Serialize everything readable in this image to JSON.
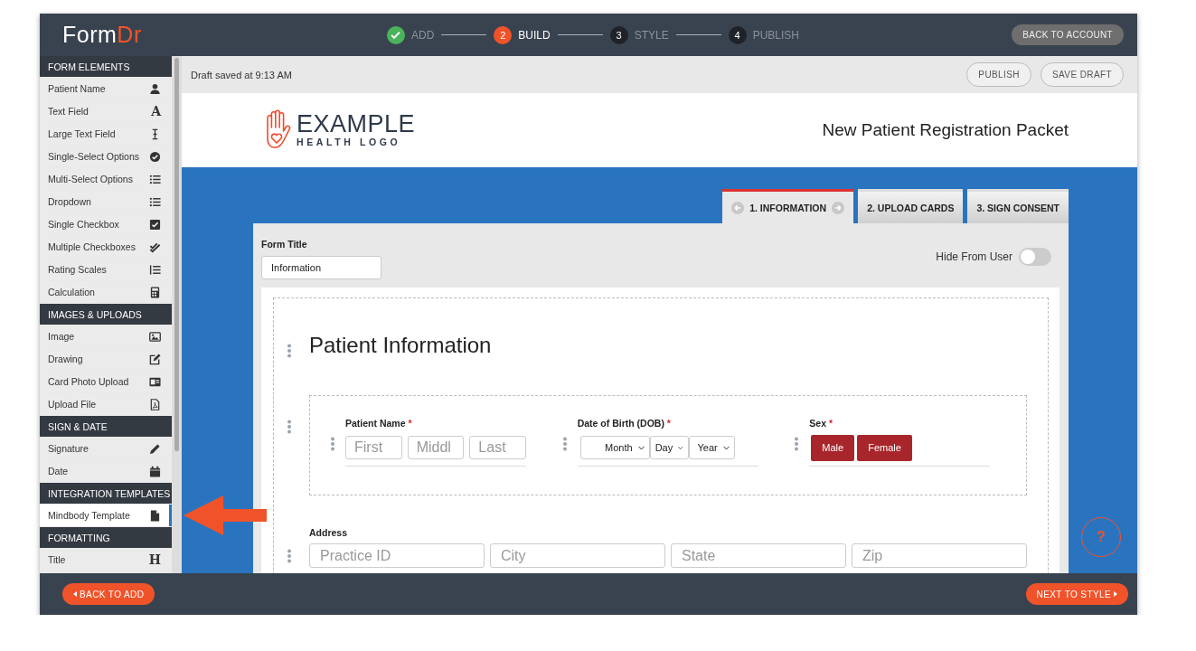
{
  "logo": [
    "Form",
    "Dr"
  ],
  "steps": [
    {
      "label": "ADD",
      "completed": true,
      "selected": false
    },
    {
      "number": "2",
      "label": "BUILD",
      "completed": false,
      "selected": true
    },
    {
      "number": "3",
      "label": "STYLE",
      "completed": false,
      "selected": false
    },
    {
      "number": "4",
      "label": "PUBLISH",
      "completed": false,
      "selected": false
    }
  ],
  "account_button": "BACK TO ACCOUNT",
  "sidebar": {
    "sections": [
      {
        "title": "FORM ELEMENTS",
        "items": [
          {
            "label": "Patient Name",
            "selected": false
          },
          {
            "label": "Text Field",
            "icon_text": "A",
            "selected": false
          },
          {
            "label": "Large Text Field",
            "selected": false
          },
          {
            "label": "Single-Select Options",
            "selected": false
          },
          {
            "label": "Multi-Select Options",
            "selected": false
          },
          {
            "label": "Dropdown",
            "selected": false
          },
          {
            "label": "Single Checkbox",
            "selected": false
          },
          {
            "label": "Multiple Checkboxes",
            "selected": false
          },
          {
            "label": "Rating Scales",
            "selected": false
          },
          {
            "label": "Calculation",
            "selected": false
          }
        ]
      },
      {
        "title": "IMAGES & UPLOADS",
        "items": [
          {
            "label": "Image",
            "selected": false
          },
          {
            "label": "Drawing",
            "selected": false
          },
          {
            "label": "Card Photo Upload",
            "selected": false
          },
          {
            "label": "Upload File",
            "selected": false
          }
        ]
      },
      {
        "title": "SIGN & DATE",
        "items": [
          {
            "label": "Signature",
            "selected": false
          },
          {
            "label": "Date",
            "selected": false
          }
        ]
      },
      {
        "title": "INTEGRATION TEMPLATES",
        "items": [
          {
            "label": "Mindbody Template",
            "selected": true
          }
        ]
      },
      {
        "title": "FORMATTING",
        "items": [
          {
            "label": "Title",
            "icon_text": "H",
            "selected": false
          }
        ]
      }
    ]
  },
  "toolbar": {
    "status": "Draft saved at 9:13 AM",
    "buttons": [
      "PUBLISH",
      "SAVE DRAFT"
    ]
  },
  "header": {
    "logo": [
      "EXAMPLE",
      "HEALTH LOGO"
    ],
    "title": "New Patient Registration Packet"
  },
  "tabs": [
    {
      "label": "1. INFORMATION",
      "selected": true
    },
    {
      "label": "2. UPLOAD CARDS",
      "selected": false
    },
    {
      "label": "3. SIGN CONSENT",
      "selected": false
    }
  ],
  "form": {
    "title_label": "Form Title",
    "title_value": "Information",
    "hide_label": "Hide From User",
    "hide_on": false,
    "section_title": "Patient Information",
    "fields": [
      {
        "kind": "inputs",
        "label": "Patient Name",
        "required_mark": "*",
        "placeholders": [
          "First",
          "Middl",
          "Last"
        ]
      },
      {
        "kind": "selects",
        "label": "Date of Birth (DOB)",
        "required_mark": "*",
        "items": [
          "Month",
          "Day",
          "Year"
        ]
      },
      {
        "kind": "choices",
        "label": "Sex",
        "required_mark": "*",
        "items": [
          "Male",
          "Female"
        ]
      }
    ],
    "address": {
      "label": "Address",
      "placeholders": [
        "Practice ID",
        "City",
        "State",
        "Zip"
      ]
    }
  },
  "help": "?",
  "footer": {
    "back": "BACK TO ADD",
    "next": "NEXT TO STYLE"
  }
}
